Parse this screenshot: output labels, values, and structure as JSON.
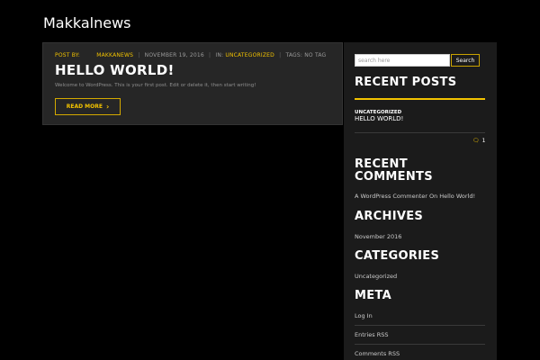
{
  "site": {
    "title": "Makkalnews"
  },
  "post": {
    "meta": {
      "post_by_label": "POST BY:",
      "author": "MAKKANEWS",
      "date": "NOVEMBER 19, 2016",
      "in_label": "IN:",
      "category": "UNCATEGORIZED",
      "tags": "TAGS: NO TAG"
    },
    "title": "HELLO WORLD!",
    "excerpt": "Welcome to WordPress. This is your first post. Edit or delete it, then start writing!",
    "read_more": "READ MORE"
  },
  "sidebar": {
    "search": {
      "placeholder": "search here",
      "button": "Search"
    },
    "recent_posts": {
      "title": "RECENT POSTS",
      "items": [
        {
          "category": "UNCATEGORIZED",
          "title": "HELLO WORLD!",
          "comments": "1"
        }
      ]
    },
    "recent_comments": {
      "title_line1": "RECENT",
      "title_line2": "COMMENTS",
      "items": [
        "A WordPress Commenter On Hello World!"
      ]
    },
    "archives": {
      "title": "ARCHIVES",
      "items": [
        "November 2016"
      ]
    },
    "categories": {
      "title": "CATEGORIES",
      "items": [
        "Uncategorized"
      ]
    },
    "meta": {
      "title": "META",
      "items": [
        "Log In",
        "Entries RSS",
        "Comments RSS"
      ]
    }
  },
  "colors": {
    "accent": "#f2c200",
    "card": "#262626",
    "sidebar": "#1b1b1b",
    "background": "#000000"
  }
}
